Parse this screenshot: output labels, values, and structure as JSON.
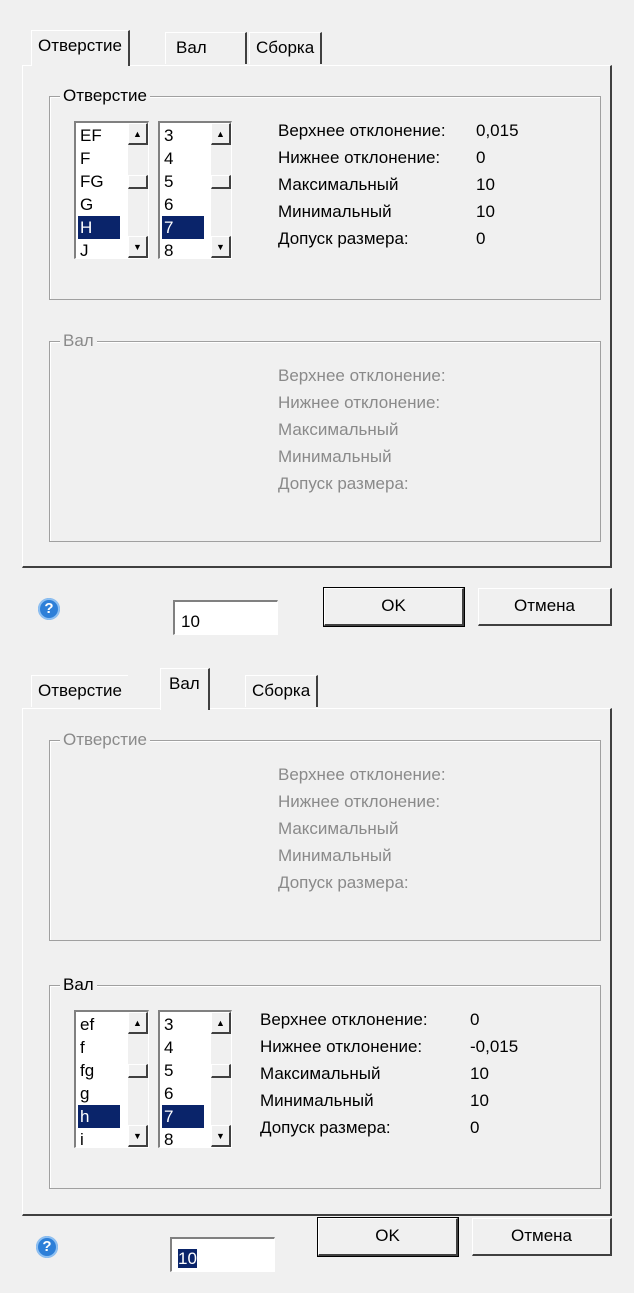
{
  "tabs": [
    "Отверстие",
    "Вал",
    "Сборка"
  ],
  "info_labels": [
    "Верхнее отклонение:",
    "Нижнее отклонение:",
    "Максимальный",
    "Минимальный",
    "Допуск размера:"
  ],
  "dialog1": {
    "active_tab": "Отверстие",
    "hole_group": {
      "title": "Отверстие",
      "letters": [
        "EF",
        "F",
        "FG",
        "G",
        "H",
        "J"
      ],
      "selected_letter": "H",
      "grades": [
        "3",
        "4",
        "5",
        "6",
        "7",
        "8"
      ],
      "selected_grade": "7",
      "values": [
        "0,015",
        "0",
        "10",
        "10",
        "0"
      ]
    },
    "shaft_group": {
      "title": "Вал",
      "disabled": true
    },
    "size_value": "10",
    "ok_label": "OK",
    "cancel_label": "Отмена",
    "help_label": "?"
  },
  "dialog2": {
    "active_tab": "Вал",
    "hole_group": {
      "title": "Отверстие",
      "disabled": true
    },
    "shaft_group": {
      "title": "Вал",
      "letters": [
        "ef",
        "f",
        "fg",
        "g",
        "h",
        "i"
      ],
      "selected_letter": "h",
      "grades": [
        "3",
        "4",
        "5",
        "6",
        "7",
        "8"
      ],
      "selected_grade": "7",
      "values": [
        "0",
        "-0,015",
        "10",
        "10",
        "0"
      ]
    },
    "size_value": "10",
    "ok_label": "OK",
    "cancel_label": "Отмена",
    "help_label": "?"
  },
  "icons": {
    "help": "help-icon",
    "scroll_up": "scroll-up-icon",
    "scroll_down": "scroll-down-icon"
  },
  "colors": {
    "selection": "#0a246a",
    "help_icon": "#2d7fd8",
    "disabled_text": "#8a8a8a"
  }
}
